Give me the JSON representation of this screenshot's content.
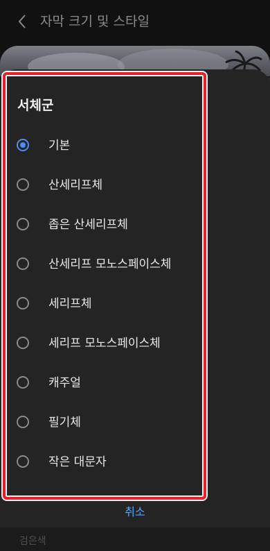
{
  "header": {
    "title": "자막 크기 및 스타일"
  },
  "dialog": {
    "title": "서체군",
    "options": [
      {
        "label": "기본",
        "selected": true
      },
      {
        "label": "산세리프체",
        "selected": false
      },
      {
        "label": "좁은 산세리프체",
        "selected": false
      },
      {
        "label": "산세리프 모노스페이스체",
        "selected": false
      },
      {
        "label": "세리프체",
        "selected": false
      },
      {
        "label": "세리프 모노스페이스체",
        "selected": false
      },
      {
        "label": "캐주얼",
        "selected": false
      },
      {
        "label": "필기체",
        "selected": false
      },
      {
        "label": "작은 대문자",
        "selected": false
      }
    ],
    "cancel_label": "취소"
  },
  "background": {
    "faded_label": "검은색"
  },
  "colors": {
    "accent": "#4d8df6",
    "highlight_border": "#e5222b",
    "dialog_bg": "#242424"
  }
}
